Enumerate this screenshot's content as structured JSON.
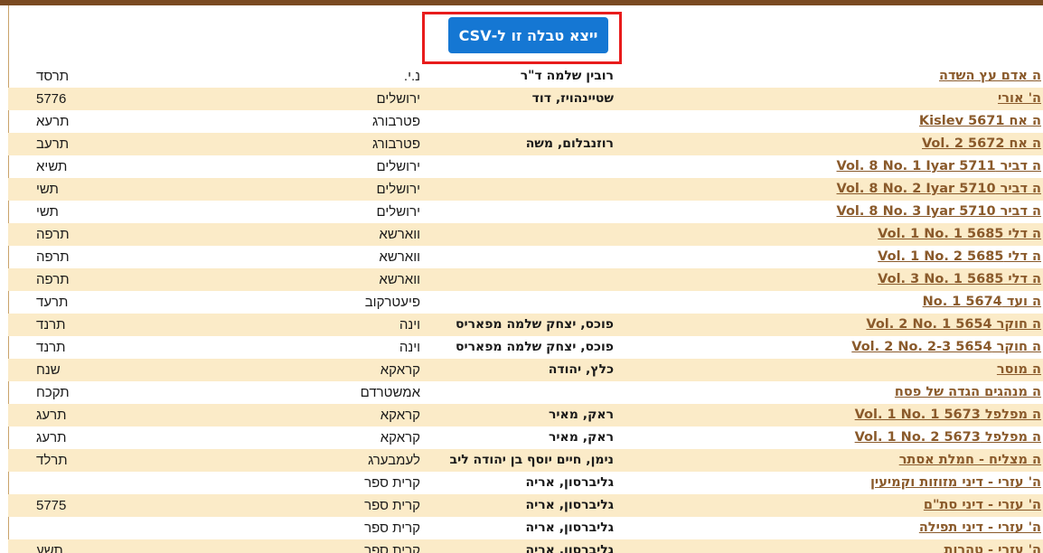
{
  "export_button": {
    "label": "ייצא טבלה זו ל-CSV"
  },
  "rows": [
    {
      "title": "ה אדם עץ השדה",
      "author": "רובין שלמה ד\"ר",
      "place": "נ.י.",
      "year": "תרסד"
    },
    {
      "title": "ה' אורי",
      "author": "שטיינהויז, דוד",
      "place": "ירושלים",
      "year": "5776"
    },
    {
      "title": "ה אח Kislev 5671",
      "author": "",
      "place": "פטרבורג",
      "year": "תרעא"
    },
    {
      "title": "ה אח Vol. 2 5672",
      "author": "רוזנבלום, משה",
      "place": "פטרבורג",
      "year": "תרעב"
    },
    {
      "title": "ה דביר Vol. 8 No. 1 Iyar 5711",
      "author": "",
      "place": "ירושלים",
      "year": "תשיא"
    },
    {
      "title": "ה דביר Vol. 8 No. 2 Iyar 5710",
      "author": "",
      "place": "ירושלים",
      "year": "תשי"
    },
    {
      "title": "ה דביר Vol. 8 No. 3 Iyar 5710",
      "author": "",
      "place": "ירושלים",
      "year": "תשי"
    },
    {
      "title": "ה דלי Vol. 1 No. 1 5685",
      "author": "",
      "place": "ווארשא",
      "year": "תרפה"
    },
    {
      "title": "ה דלי Vol. 1 No. 2 5685",
      "author": "",
      "place": "ווארשא",
      "year": "תרפה"
    },
    {
      "title": "ה דלי Vol. 3 No. 1 5685",
      "author": "",
      "place": "ווארשא",
      "year": "תרפה"
    },
    {
      "title": "ה ועד No. 1 5674",
      "author": "",
      "place": "פיעטרקוב",
      "year": "תרעד"
    },
    {
      "title": "ה חוקר Vol. 2 No. 1 5654",
      "author": "פוכס, יצחק שלמה מפאריס",
      "place": "וינה",
      "year": "תרנד"
    },
    {
      "title": "ה חוקר Vol. 2 No. 2-3 5654",
      "author": "פוכס, יצחק שלמה מפאריס",
      "place": "וינה",
      "year": "תרנד"
    },
    {
      "title": "ה מוסר",
      "author": "כלץ, יהודה",
      "place": "קראקא",
      "year": "שנח"
    },
    {
      "title": "ה מנהגים הגדה של פסח",
      "author": "",
      "place": "אמשטרדם",
      "year": "תקכח"
    },
    {
      "title": "ה מפלפל Vol. 1 No. 1 5673",
      "author": "ראק, מאיר",
      "place": "קראקא",
      "year": "תרעג"
    },
    {
      "title": "ה מפלפל Vol. 1 No. 2 5673",
      "author": "ראק, מאיר",
      "place": "קראקא",
      "year": "תרעג"
    },
    {
      "title": "ה מצליח - חמלת אסתר",
      "author": "נימן, חיים יוסף בן יהודה ליב",
      "place": "לעמבערג",
      "year": "תרלד"
    },
    {
      "title": "ה' עזרי - דיני מזוזות וקמיעין",
      "author": "גליברסון, אריה",
      "place": "קרית ספר",
      "year": ""
    },
    {
      "title": "ה' עזרי - דיני סת\"ם",
      "author": "גליברסון, אריה",
      "place": "קרית ספר",
      "year": "5775"
    },
    {
      "title": "ה' עזרי - דיני תפילה",
      "author": "גליברסון, אריה",
      "place": "קרית ספר",
      "year": ""
    },
    {
      "title": "ה' עזרי - טהרות",
      "author": "גליברסון, אריה",
      "place": "קרית ספר",
      "year": "תשע"
    }
  ]
}
